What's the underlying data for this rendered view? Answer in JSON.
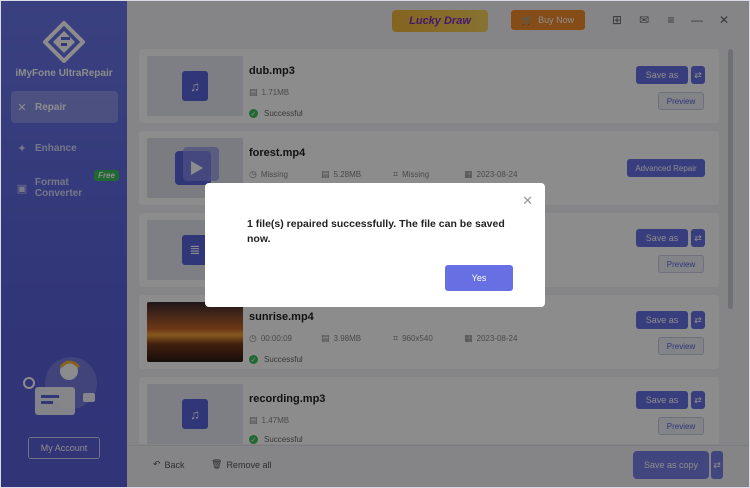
{
  "app": {
    "name": "iMyFone UltraRepair"
  },
  "sidebar": {
    "items": [
      {
        "label": "Repair",
        "icon": "repair-icon",
        "active": true
      },
      {
        "label": "Enhance",
        "icon": "enhance-icon",
        "active": false
      },
      {
        "label": "Format Converter",
        "icon": "format-converter-icon",
        "active": false,
        "badge": "Free"
      }
    ],
    "account_label": "My Account"
  },
  "titlebar": {
    "lucky_draw": "Lucky Draw",
    "buy_now": "Buy Now"
  },
  "files": [
    {
      "name": "dub.mp3",
      "size": "1.71MB",
      "status": "Successful",
      "primary_label": "Save as",
      "preview_label": "Preview"
    },
    {
      "name": "forest.mp4",
      "duration": "Missing",
      "size": "5.28MB",
      "resolution": "Missing",
      "date": "2023-08-24",
      "primary_label": "Advanced Repair"
    },
    {
      "primary_label": "Save as",
      "preview_label": "Preview"
    },
    {
      "name": "sunrise.mp4",
      "duration": "00:00:09",
      "size": "3.98MB",
      "resolution": "960x540",
      "date": "2023-08-24",
      "status": "Successful",
      "primary_label": "Save as",
      "preview_label": "Preview"
    },
    {
      "name": "recording.mp3",
      "size": "1.47MB",
      "status": "Successful",
      "primary_label": "Save as",
      "preview_label": "Preview"
    }
  ],
  "bottombar": {
    "back_label": "Back",
    "remove_all_label": "Remove all",
    "save_all_label": "Save as copy"
  },
  "dialog": {
    "message": "1 file(s) repaired successfully. The file can be saved now.",
    "yes_label": "Yes"
  },
  "colors": {
    "accent": "#6670e3",
    "sidebar": "#5a63dc",
    "success": "#3bbf5c",
    "buy": "#f38b2a"
  }
}
